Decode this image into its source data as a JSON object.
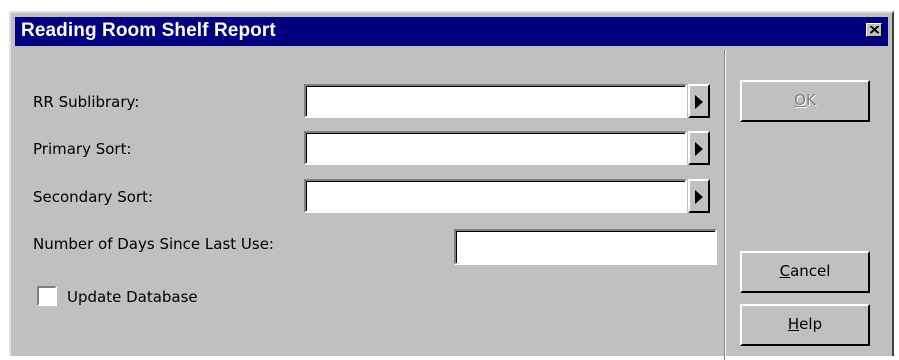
{
  "window": {
    "title": "Reading Room Shelf Report",
    "close_icon": "close-icon"
  },
  "form": {
    "sublibrary_label": "RR Sublibrary:",
    "sublibrary_value": "",
    "primary_sort_label": "Primary Sort:",
    "primary_sort_value": "",
    "secondary_sort_label": "Secondary Sort:",
    "secondary_sort_value": "",
    "days_label": "Number of Days Since Last Use:",
    "days_value": "",
    "update_db_label": "Update Database",
    "update_db_checked": false
  },
  "buttons": {
    "ok_prefix": "",
    "ok_mnemonic": "O",
    "ok_rest": "K",
    "cancel_mnemonic": "C",
    "cancel_rest": "ancel",
    "help_mnemonic": "H",
    "help_rest": "elp"
  },
  "colors": {
    "titlebar": "#000080",
    "dialog_bg": "#c0c0c0"
  }
}
